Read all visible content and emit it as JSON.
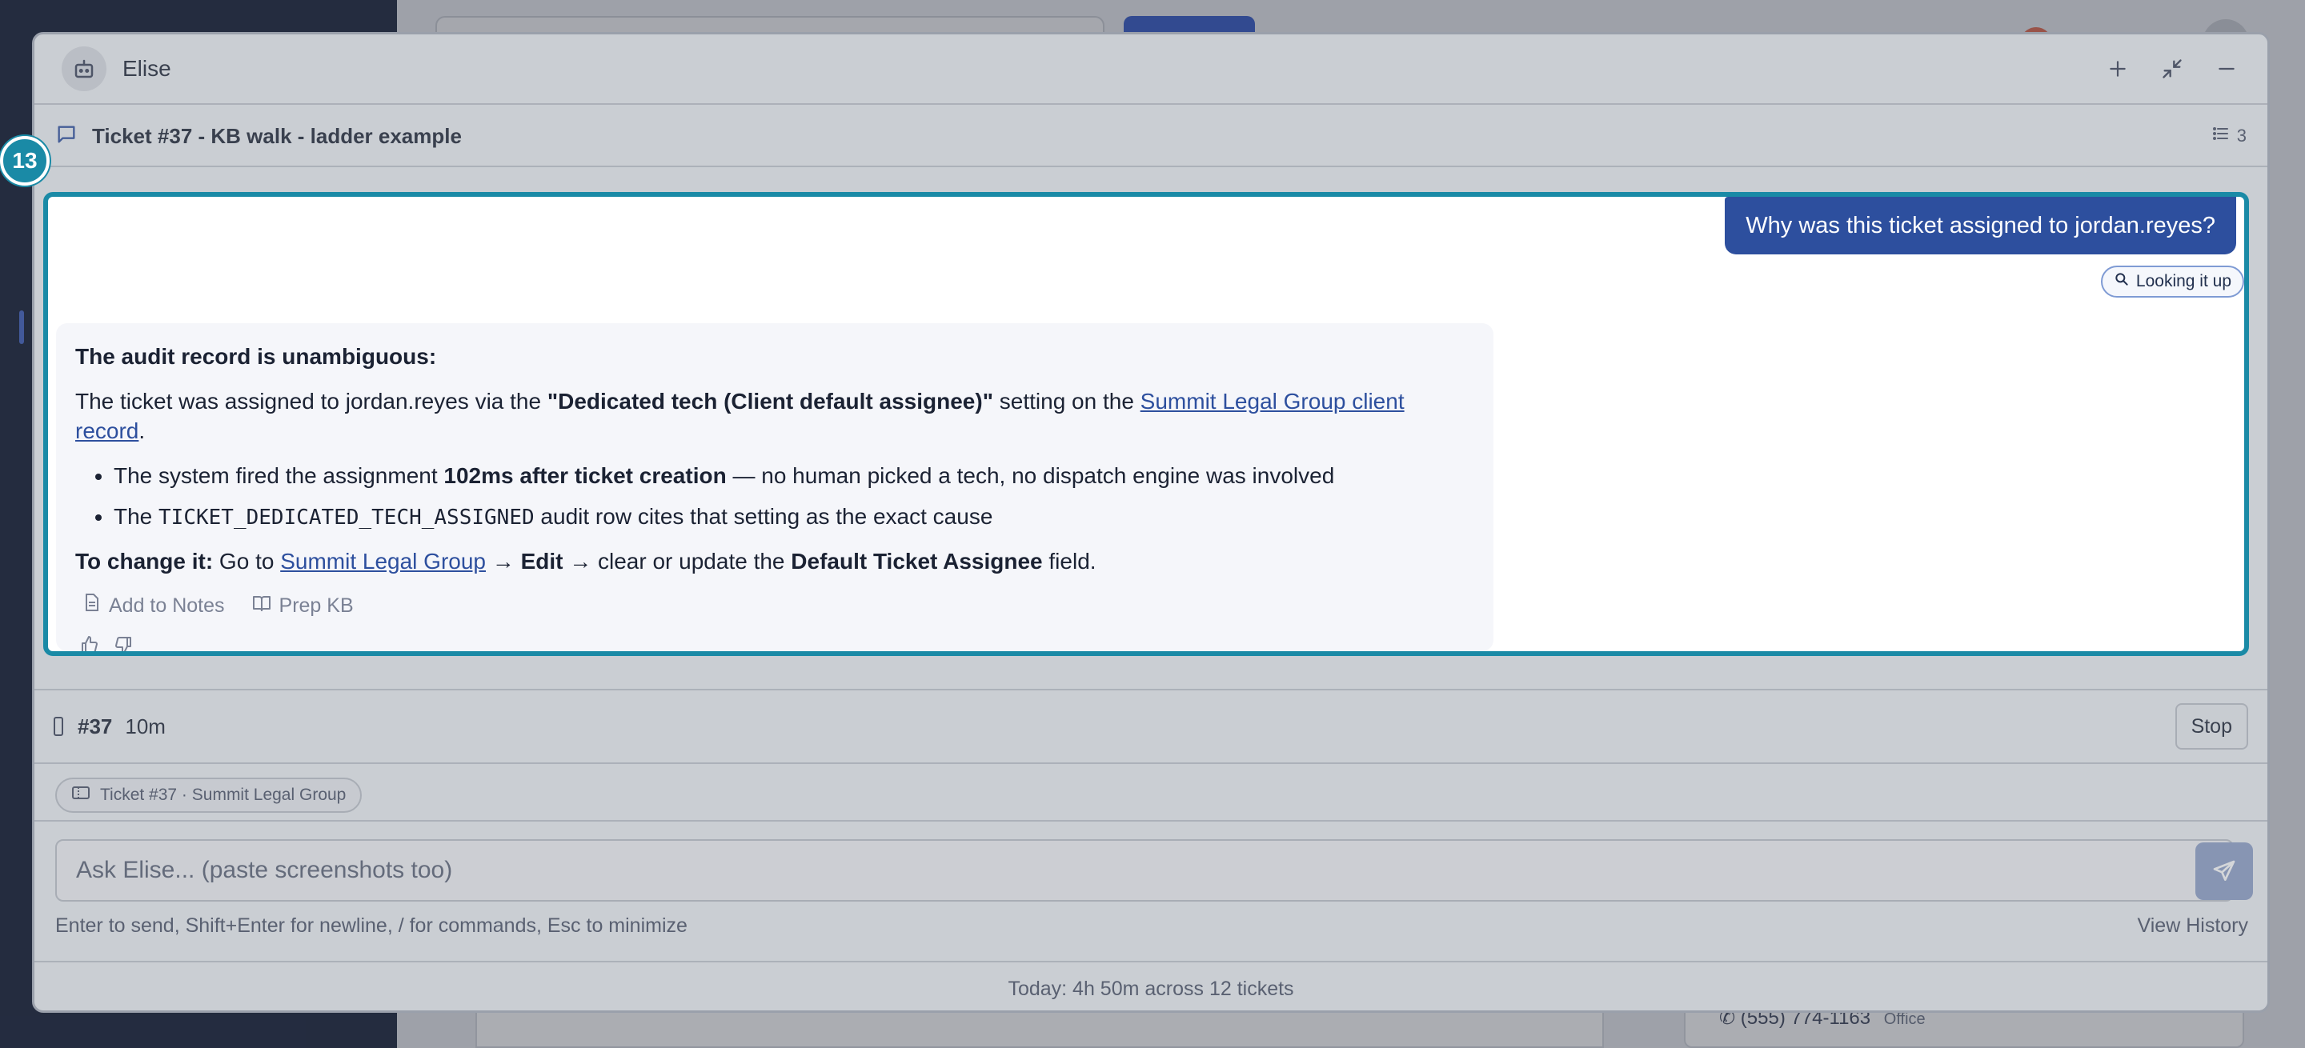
{
  "panel": {
    "assistant_name": "Elise",
    "ticket_title": "Ticket #37 - KB walk - ladder example",
    "thread_count": "3"
  },
  "annotation": {
    "badge": "13"
  },
  "conversation": {
    "user_message": "Why was this ticket assigned to jordan.reyes?",
    "lookup_status": "Looking it up",
    "response": {
      "heading": "The audit record is unambiguous:",
      "p1_a": "The ticket was assigned to jordan.reyes via the ",
      "p1_bold": "\"Dedicated tech (Client default assignee)\"",
      "p1_b": " setting on the ",
      "p1_link": "Summit Legal Group client record",
      "p1_end": ".",
      "b1_a": "The system fired the assignment ",
      "b1_bold": "102ms after ticket creation",
      "b1_b": " — no human picked a tech, no dispatch engine was involved",
      "b2_a": "The ",
      "b2_code": "TICKET_DEDICATED_TECH_ASSIGNED",
      "b2_b": " audit row cites that setting as the exact cause",
      "change_bold": "To change it:",
      "change_a": " Go to ",
      "change_link": "Summit Legal Group",
      "change_arrow1": " → ",
      "change_edit": "Edit",
      "change_b": " → clear or update the ",
      "change_field": "Default Ticket Assignee",
      "change_end": " field."
    },
    "actions": {
      "add_notes": "Add to Notes",
      "prep_kb": "Prep KB"
    }
  },
  "status": {
    "ticket_num": "#37",
    "elapsed": "10m",
    "stop_label": "Stop"
  },
  "context_chip": "Ticket #37 · Summit Legal Group",
  "input": {
    "placeholder": "Ask Elise... (paste screenshots too)"
  },
  "hint": "Enter to send, Shift+Enter for newline, / for commands, Esc to minimize",
  "history_label": "View History",
  "footer": "Today: 4h 50m across 12 tickets",
  "background": {
    "phone": "(555) 774-1163",
    "phone_type": "Office"
  },
  "colors": {
    "accent": "#1a8aa6",
    "user_bubble": "#2d4f9e",
    "link": "#2d4f9e"
  }
}
